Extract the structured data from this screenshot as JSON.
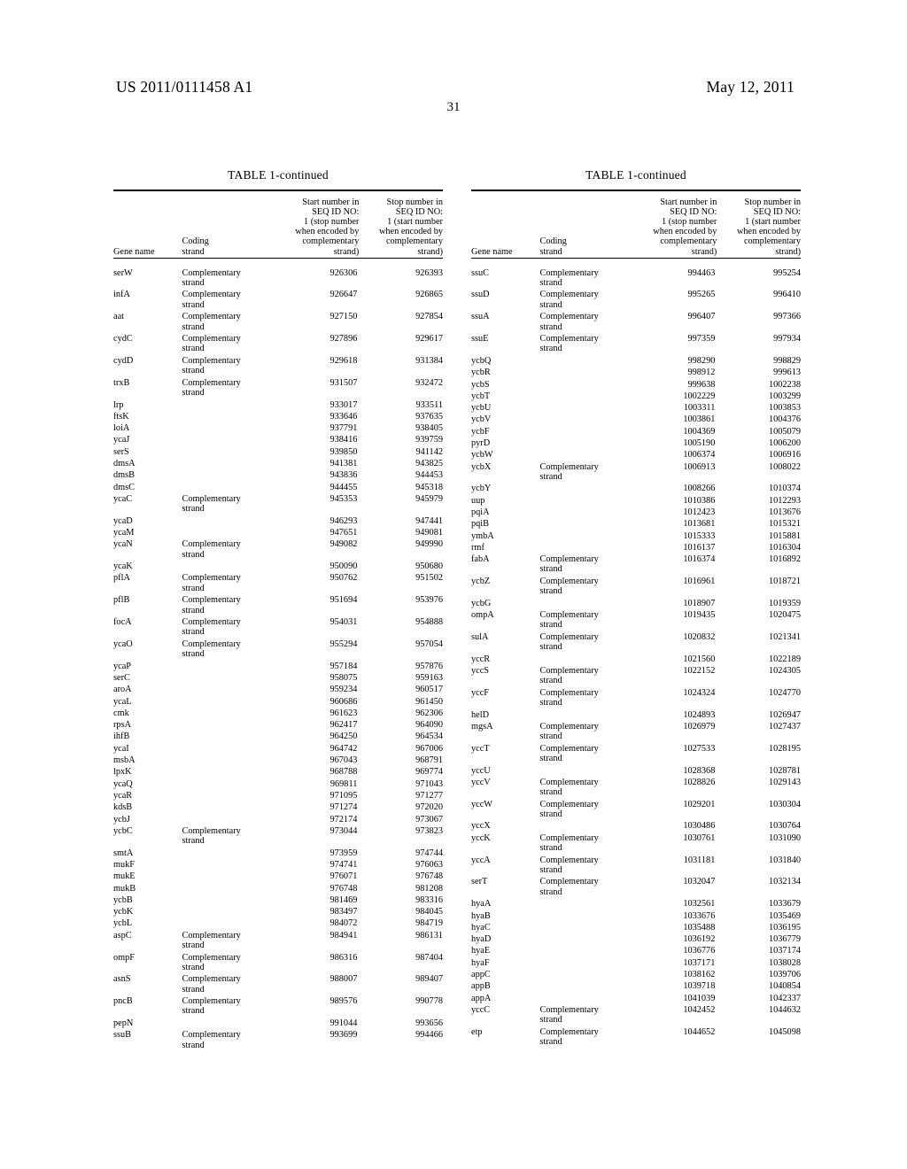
{
  "header": {
    "patent_number": "US 2011/0111458 A1",
    "date": "May 12, 2011",
    "page_number": "31"
  },
  "table_caption": "TABLE 1-continued",
  "columns": {
    "gene_name": "Gene name",
    "coding_strand": [
      "Coding",
      "strand"
    ],
    "start": [
      "Start number in",
      "SEQ ID NO:",
      "1 (stop number",
      "when encoded by",
      "complementary",
      "strand)"
    ],
    "stop": [
      "Stop number in",
      "SEQ ID NO:",
      "1 (start number",
      "when encoded by",
      "complementary",
      "strand)"
    ]
  },
  "strand_complementary": [
    "Complementary",
    "strand"
  ],
  "left_table": {
    "caption": "TABLE 1-continued",
    "rows": [
      {
        "gene": "serW",
        "strand": "complementary",
        "start": "926306",
        "stop": "926393"
      },
      {
        "gene": "infA",
        "strand": "complementary",
        "start": "926647",
        "stop": "926865"
      },
      {
        "gene": "aat",
        "strand": "complementary",
        "start": "927150",
        "stop": "927854"
      },
      {
        "gene": "cydC",
        "strand": "complementary",
        "start": "927896",
        "stop": "929617"
      },
      {
        "gene": "cydD",
        "strand": "complementary",
        "start": "929618",
        "stop": "931384"
      },
      {
        "gene": "trxB",
        "strand": "complementary",
        "start": "931507",
        "stop": "932472"
      },
      {
        "gene": "lrp",
        "strand": "",
        "start": "933017",
        "stop": "933511"
      },
      {
        "gene": "ftsK",
        "strand": "",
        "start": "933646",
        "stop": "937635"
      },
      {
        "gene": "loiA",
        "strand": "",
        "start": "937791",
        "stop": "938405"
      },
      {
        "gene": "ycaJ",
        "strand": "",
        "start": "938416",
        "stop": "939759"
      },
      {
        "gene": "serS",
        "strand": "",
        "start": "939850",
        "stop": "941142"
      },
      {
        "gene": "dmsA",
        "strand": "",
        "start": "941381",
        "stop": "943825"
      },
      {
        "gene": "dmsB",
        "strand": "",
        "start": "943836",
        "stop": "944453"
      },
      {
        "gene": "dmsC",
        "strand": "",
        "start": "944455",
        "stop": "945318"
      },
      {
        "gene": "ycaC",
        "strand": "complementary",
        "start": "945353",
        "stop": "945979"
      },
      {
        "gene": "ycaD",
        "strand": "",
        "start": "946293",
        "stop": "947441"
      },
      {
        "gene": "ycaM",
        "strand": "",
        "start": "947651",
        "stop": "949081"
      },
      {
        "gene": "ycaN",
        "strand": "complementary",
        "start": "949082",
        "stop": "949990"
      },
      {
        "gene": "ycaK",
        "strand": "",
        "start": "950090",
        "stop": "950680"
      },
      {
        "gene": "pflA",
        "strand": "complementary",
        "start": "950762",
        "stop": "951502"
      },
      {
        "gene": "pflB",
        "strand": "complementary",
        "start": "951694",
        "stop": "953976"
      },
      {
        "gene": "focA",
        "strand": "complementary",
        "start": "954031",
        "stop": "954888"
      },
      {
        "gene": "ycaO",
        "strand": "complementary",
        "start": "955294",
        "stop": "957054"
      },
      {
        "gene": "ycaP",
        "strand": "",
        "start": "957184",
        "stop": "957876"
      },
      {
        "gene": "serC",
        "strand": "",
        "start": "958075",
        "stop": "959163"
      },
      {
        "gene": "aroA",
        "strand": "",
        "start": "959234",
        "stop": "960517"
      },
      {
        "gene": "ycaL",
        "strand": "",
        "start": "960686",
        "stop": "961450"
      },
      {
        "gene": "cmk",
        "strand": "",
        "start": "961623",
        "stop": "962306"
      },
      {
        "gene": "rpsA",
        "strand": "",
        "start": "962417",
        "stop": "964090"
      },
      {
        "gene": "ihfB",
        "strand": "",
        "start": "964250",
        "stop": "964534"
      },
      {
        "gene": "ycaI",
        "strand": "",
        "start": "964742",
        "stop": "967006"
      },
      {
        "gene": "msbA",
        "strand": "",
        "start": "967043",
        "stop": "968791"
      },
      {
        "gene": "lpxK",
        "strand": "",
        "start": "968788",
        "stop": "969774"
      },
      {
        "gene": "ycaQ",
        "strand": "",
        "start": "969811",
        "stop": "971043"
      },
      {
        "gene": "ycaR",
        "strand": "",
        "start": "971095",
        "stop": "971277"
      },
      {
        "gene": "kdsB",
        "strand": "",
        "start": "971274",
        "stop": "972020"
      },
      {
        "gene": "ycbJ",
        "strand": "",
        "start": "972174",
        "stop": "973067"
      },
      {
        "gene": "ycbC",
        "strand": "complementary",
        "start": "973044",
        "stop": "973823"
      },
      {
        "gene": "smtA",
        "strand": "",
        "start": "973959",
        "stop": "974744"
      },
      {
        "gene": "mukF",
        "strand": "",
        "start": "974741",
        "stop": "976063"
      },
      {
        "gene": "mukE",
        "strand": "",
        "start": "976071",
        "stop": "976748"
      },
      {
        "gene": "mukB",
        "strand": "",
        "start": "976748",
        "stop": "981208"
      },
      {
        "gene": "ycbB",
        "strand": "",
        "start": "981469",
        "stop": "983316"
      },
      {
        "gene": "ycbK",
        "strand": "",
        "start": "983497",
        "stop": "984045"
      },
      {
        "gene": "ycbL",
        "strand": "",
        "start": "984072",
        "stop": "984719"
      },
      {
        "gene": "aspC",
        "strand": "complementary",
        "start": "984941",
        "stop": "986131"
      },
      {
        "gene": "ompF",
        "strand": "complementary",
        "start": "986316",
        "stop": "987404"
      },
      {
        "gene": "asnS",
        "strand": "complementary",
        "start": "988007",
        "stop": "989407"
      },
      {
        "gene": "pncB",
        "strand": "complementary",
        "start": "989576",
        "stop": "990778"
      },
      {
        "gene": "pepN",
        "strand": "",
        "start": "991044",
        "stop": "993656"
      },
      {
        "gene": "ssuB",
        "strand": "complementary",
        "start": "993699",
        "stop": "994466"
      }
    ]
  },
  "right_table": {
    "caption": "TABLE 1-continued",
    "rows": [
      {
        "gene": "ssuC",
        "strand": "complementary",
        "start": "994463",
        "stop": "995254"
      },
      {
        "gene": "ssuD",
        "strand": "complementary",
        "start": "995265",
        "stop": "996410"
      },
      {
        "gene": "ssuA",
        "strand": "complementary",
        "start": "996407",
        "stop": "997366"
      },
      {
        "gene": "ssuE",
        "strand": "complementary",
        "start": "997359",
        "stop": "997934"
      },
      {
        "gene": "ycbQ",
        "strand": "",
        "start": "998290",
        "stop": "998829"
      },
      {
        "gene": "ycbR",
        "strand": "",
        "start": "998912",
        "stop": "999613"
      },
      {
        "gene": "ycbS",
        "strand": "",
        "start": "999638",
        "stop": "1002238"
      },
      {
        "gene": "ycbT",
        "strand": "",
        "start": "1002229",
        "stop": "1003299"
      },
      {
        "gene": "ycbU",
        "strand": "",
        "start": "1003311",
        "stop": "1003853"
      },
      {
        "gene": "ycbV",
        "strand": "",
        "start": "1003861",
        "stop": "1004376"
      },
      {
        "gene": "ycbF",
        "strand": "",
        "start": "1004369",
        "stop": "1005079"
      },
      {
        "gene": "pyrD",
        "strand": "",
        "start": "1005190",
        "stop": "1006200"
      },
      {
        "gene": "ycbW",
        "strand": "",
        "start": "1006374",
        "stop": "1006916"
      },
      {
        "gene": "ycbX",
        "strand": "complementary",
        "start": "1006913",
        "stop": "1008022"
      },
      {
        "gene": "ycbY",
        "strand": "",
        "start": "1008266",
        "stop": "1010374"
      },
      {
        "gene": "uup",
        "strand": "",
        "start": "1010386",
        "stop": "1012293"
      },
      {
        "gene": "pqiA",
        "strand": "",
        "start": "1012423",
        "stop": "1013676"
      },
      {
        "gene": "pqiB",
        "strand": "",
        "start": "1013681",
        "stop": "1015321"
      },
      {
        "gene": "ymbA",
        "strand": "",
        "start": "1015333",
        "stop": "1015881"
      },
      {
        "gene": "rmf",
        "strand": "",
        "start": "1016137",
        "stop": "1016304"
      },
      {
        "gene": "fabA",
        "strand": "complementary",
        "start": "1016374",
        "stop": "1016892"
      },
      {
        "gene": "ycbZ",
        "strand": "complementary",
        "start": "1016961",
        "stop": "1018721"
      },
      {
        "gene": "ycbG",
        "strand": "",
        "start": "1018907",
        "stop": "1019359"
      },
      {
        "gene": "ompA",
        "strand": "complementary",
        "start": "1019435",
        "stop": "1020475"
      },
      {
        "gene": "sulA",
        "strand": "complementary",
        "start": "1020832",
        "stop": "1021341"
      },
      {
        "gene": "yccR",
        "strand": "",
        "start": "1021560",
        "stop": "1022189"
      },
      {
        "gene": "yccS",
        "strand": "complementary",
        "start": "1022152",
        "stop": "1024305"
      },
      {
        "gene": "yccF",
        "strand": "complementary",
        "start": "1024324",
        "stop": "1024770"
      },
      {
        "gene": "helD",
        "strand": "",
        "start": "1024893",
        "stop": "1026947"
      },
      {
        "gene": "mgsA",
        "strand": "complementary",
        "start": "1026979",
        "stop": "1027437"
      },
      {
        "gene": "yccT",
        "strand": "complementary",
        "start": "1027533",
        "stop": "1028195"
      },
      {
        "gene": "yccU",
        "strand": "",
        "start": "1028368",
        "stop": "1028781"
      },
      {
        "gene": "yccV",
        "strand": "complementary",
        "start": "1028826",
        "stop": "1029143"
      },
      {
        "gene": "yccW",
        "strand": "complementary",
        "start": "1029201",
        "stop": "1030304"
      },
      {
        "gene": "yccX",
        "strand": "",
        "start": "1030486",
        "stop": "1030764"
      },
      {
        "gene": "yccK",
        "strand": "complementary",
        "start": "1030761",
        "stop": "1031090"
      },
      {
        "gene": "yccA",
        "strand": "complementary",
        "start": "1031181",
        "stop": "1031840"
      },
      {
        "gene": "serT",
        "strand": "complementary",
        "start": "1032047",
        "stop": "1032134"
      },
      {
        "gene": "hyaA",
        "strand": "",
        "start": "1032561",
        "stop": "1033679"
      },
      {
        "gene": "hyaB",
        "strand": "",
        "start": "1033676",
        "stop": "1035469"
      },
      {
        "gene": "hyaC",
        "strand": "",
        "start": "1035488",
        "stop": "1036195"
      },
      {
        "gene": "hyaD",
        "strand": "",
        "start": "1036192",
        "stop": "1036779"
      },
      {
        "gene": "hyaE",
        "strand": "",
        "start": "1036776",
        "stop": "1037174"
      },
      {
        "gene": "hyaF",
        "strand": "",
        "start": "1037171",
        "stop": "1038028"
      },
      {
        "gene": "appC",
        "strand": "",
        "start": "1038162",
        "stop": "1039706"
      },
      {
        "gene": "appB",
        "strand": "",
        "start": "1039718",
        "stop": "1040854"
      },
      {
        "gene": "appA",
        "strand": "",
        "start": "1041039",
        "stop": "1042337"
      },
      {
        "gene": "yccC",
        "strand": "complementary",
        "start": "1042452",
        "stop": "1044632"
      },
      {
        "gene": "etp",
        "strand": "complementary",
        "start": "1044652",
        "stop": "1045098"
      }
    ]
  }
}
